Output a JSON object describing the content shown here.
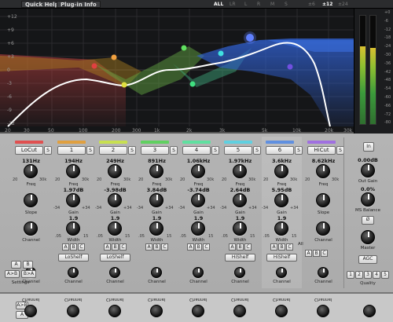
{
  "toolbar": {
    "quick_help": "Quick Help",
    "plugin_info": "Plug-in Info",
    "vis": [
      "ALL",
      "LR",
      "L",
      "R",
      "M",
      "S"
    ],
    "range": [
      "±6",
      "±12",
      "±24"
    ]
  },
  "db_labels": [
    "+12",
    "+9",
    "+6",
    "+3",
    "0",
    "-3",
    "-6",
    "-9",
    "-12"
  ],
  "freq_labels": [
    "20",
    "30",
    "50",
    "100",
    "200",
    "300",
    "1k",
    "2k",
    "3k",
    "5k",
    "10k",
    "20k",
    "30k"
  ],
  "meter_labels": [
    "+0",
    "-6",
    "-12",
    "-18",
    "-24",
    "-30",
    "-36",
    "-42",
    "-48",
    "-54",
    "-60",
    "-66",
    "-72",
    "-80"
  ],
  "bands": [
    {
      "type": "LoCut",
      "solo": "S",
      "color": "#e05050",
      "freq": "131Hz",
      "gain": "",
      "q": "",
      "shelf": ""
    },
    {
      "type": "1",
      "solo": "S",
      "color": "#e0a040",
      "freq": "194Hz",
      "gain": "1.97dB",
      "q": "1.9",
      "shelf": "LoShelf"
    },
    {
      "type": "2",
      "solo": "S",
      "color": "#c8e050",
      "freq": "249Hz",
      "gain": "-3.98dB",
      "q": "1.9",
      "shelf": "LoShelf"
    },
    {
      "type": "3",
      "solo": "S",
      "color": "#60d060",
      "freq": "891Hz",
      "gain": "3.84dB",
      "q": "1.9",
      "shelf": ""
    },
    {
      "type": "4",
      "solo": "S",
      "color": "#60e0a0",
      "freq": "1.06kHz",
      "gain": "-3.74dB",
      "q": "1.9",
      "shelf": ""
    },
    {
      "type": "5",
      "solo": "S",
      "color": "#60d0e0",
      "freq": "1.97kHz",
      "gain": "2.64dB",
      "q": "1.9",
      "shelf": "HiShelf"
    },
    {
      "type": "6",
      "solo": "S",
      "color": "#6090e0",
      "freq": "3.6kHz",
      "gain": "5.95dB",
      "q": "1.9",
      "shelf": "HiShelf"
    },
    {
      "type": "HiCut",
      "solo": "S",
      "color": "#a070e0",
      "freq": "8.62kHz",
      "gain": "",
      "q": "",
      "shelf": ""
    }
  ],
  "labels": {
    "freq": "Freq",
    "gain": "Gain",
    "width": "Width",
    "channel": "Channel",
    "slope": "Slope",
    "all": "All",
    "abc": [
      "A",
      "B",
      "C"
    ],
    "freq_min": "20",
    "freq_max": "30k",
    "gain_min": "-34",
    "gain_max": "+34",
    "w_min": ".05",
    "w_max": "15"
  },
  "settings": {
    "a": "A",
    "b": "B",
    "a2b": "A>B",
    "b2a": "B>A",
    "label": "Settings"
  },
  "right": {
    "in": "In",
    "out_gain_value": "0.00dB",
    "out_gain_label": "Out Gain",
    "ms_value": "0.0%",
    "ms_label": "MS Balance",
    "phase": "Ø",
    "master": "Master",
    "agc": "AGC",
    "quality": [
      "1",
      "2",
      "3",
      "4",
      "5"
    ],
    "quality_label": "Quality"
  }
}
